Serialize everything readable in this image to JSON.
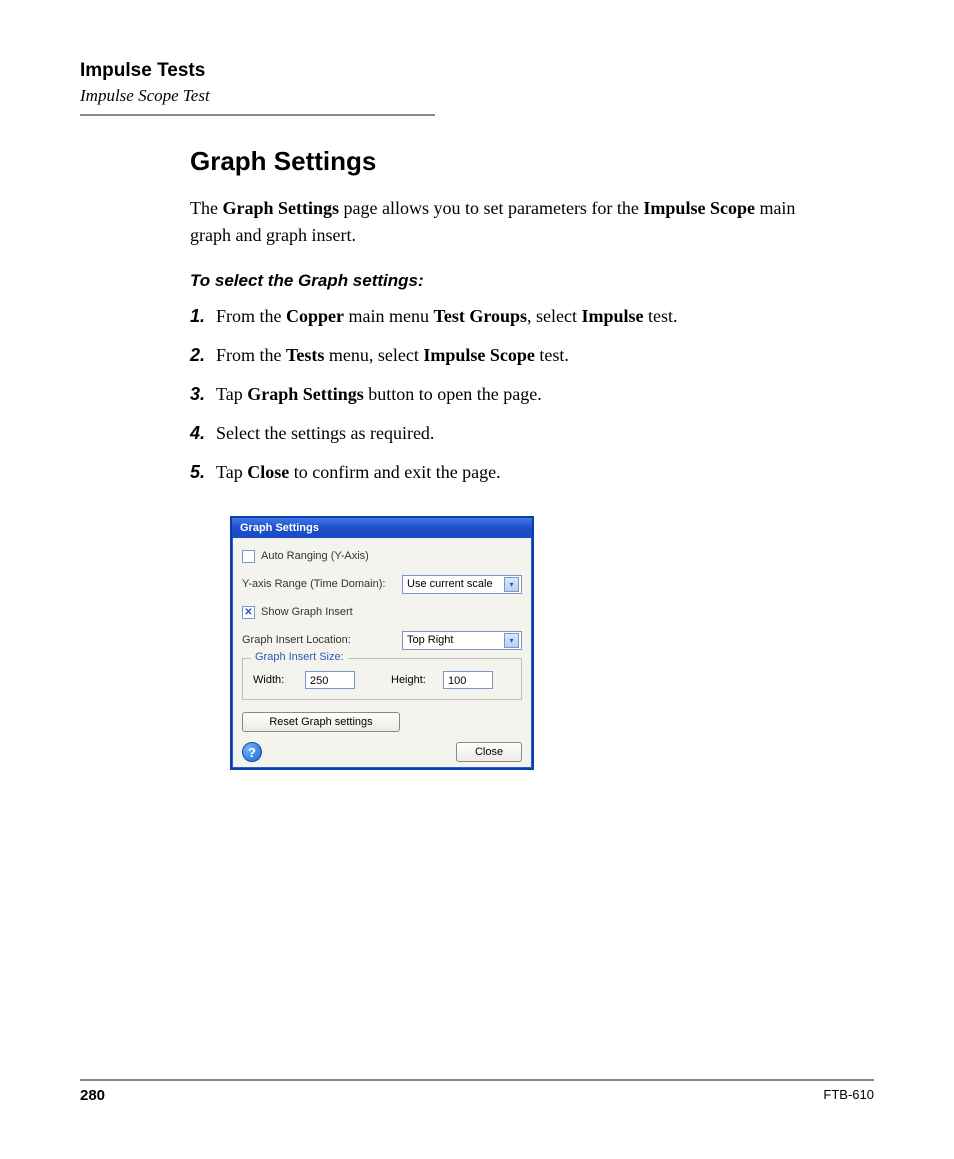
{
  "header": {
    "title": "Impulse Tests",
    "subtitle": "Impulse Scope Test"
  },
  "section": {
    "heading": "Graph Settings",
    "intro_pre": "The ",
    "intro_b1": "Graph Settings",
    "intro_mid": " page allows you to set parameters for the ",
    "intro_b2": "Impulse Scope",
    "intro_post": " main graph and graph insert."
  },
  "procedure": {
    "heading": "To select the Graph settings:",
    "steps": [
      {
        "num": "1.",
        "seg": [
          "From the ",
          "Copper",
          " main menu ",
          "Test Groups",
          ", select ",
          "Impulse",
          " test."
        ]
      },
      {
        "num": "2.",
        "seg": [
          "From the ",
          "Tests",
          " menu, select ",
          "Impulse Scope",
          " test."
        ]
      },
      {
        "num": "3.",
        "seg": [
          "Tap ",
          "Graph Settings",
          " button to open the page."
        ]
      },
      {
        "num": "4.",
        "seg": [
          "Select the settings as required."
        ]
      },
      {
        "num": "5.",
        "seg": [
          "Tap ",
          "Close",
          " to confirm and exit the page."
        ]
      }
    ]
  },
  "dialog": {
    "title": "Graph Settings",
    "auto_ranging_label": "Auto Ranging (Y-Axis)",
    "auto_ranging_checked": false,
    "yaxis_label": "Y-axis Range (Time Domain):",
    "yaxis_value": "Use current scale",
    "show_insert_label": "Show Graph Insert",
    "show_insert_checked": true,
    "insert_loc_label": "Graph Insert Location:",
    "insert_loc_value": "Top Right",
    "group_title": "Graph Insert Size:",
    "width_label": "Width:",
    "width_value": "250",
    "height_label": "Height:",
    "height_value": "100",
    "reset_label": "Reset Graph settings",
    "help_glyph": "?",
    "close_label": "Close"
  },
  "footer": {
    "page": "280",
    "model": "FTB-610"
  }
}
